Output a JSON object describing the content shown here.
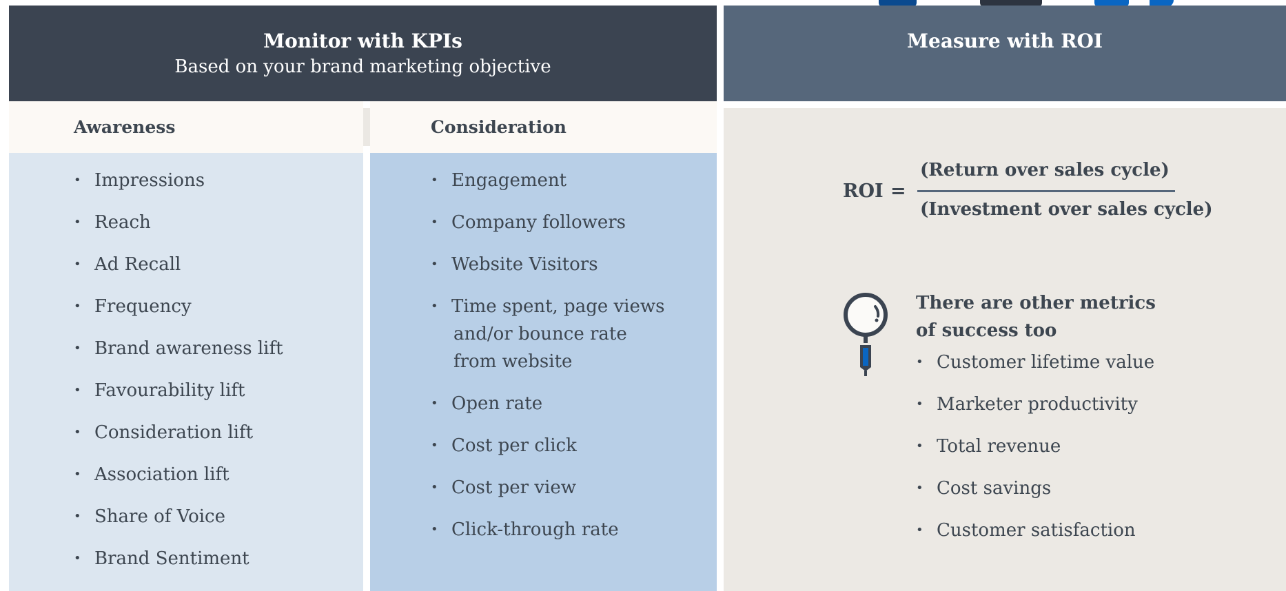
{
  "header_left": {
    "title": "Monitor with KPIs",
    "subtitle": "Based on your brand marketing objective"
  },
  "header_right": {
    "title": "Measure with ROI"
  },
  "awareness": {
    "label": "Awareness",
    "items": [
      "Impressions",
      "Reach",
      "Ad Recall",
      "Frequency",
      "Brand awareness lift",
      "Favourability lift",
      "Consideration lift",
      "Association lift",
      "Share of Voice",
      "Brand Sentiment"
    ]
  },
  "consideration": {
    "label": "Consideration",
    "items": [
      "Engagement",
      "Company followers",
      "Website Visitors",
      "Time spent, page views and/or bounce rate from website",
      "Open rate",
      "Cost per click",
      "Cost per view",
      "Click-through rate"
    ],
    "multiline_item_lines": [
      "Time spent, page views",
      "and/or bounce rate",
      "from website"
    ]
  },
  "roi": {
    "label": "ROI",
    "equals": "=",
    "numerator": "(Return over sales cycle)",
    "denominator": "(Investment over sales cycle)"
  },
  "other_metrics": {
    "title_line1": "There are other metrics",
    "title_line2": "of success too",
    "icon": "magnifying-glass-icon",
    "items": [
      "Customer lifetime value",
      "Marketer productivity",
      "Total revenue",
      "Cost savings",
      "Customer satisfaction"
    ]
  },
  "colors": {
    "header_left": "#3b4451",
    "header_right": "#56677b",
    "awareness_bg": "#dce6f0",
    "consideration_bg": "#b8cfe7",
    "roi_bg": "#ece9e4",
    "accent_blue": "#0a66c2"
  }
}
